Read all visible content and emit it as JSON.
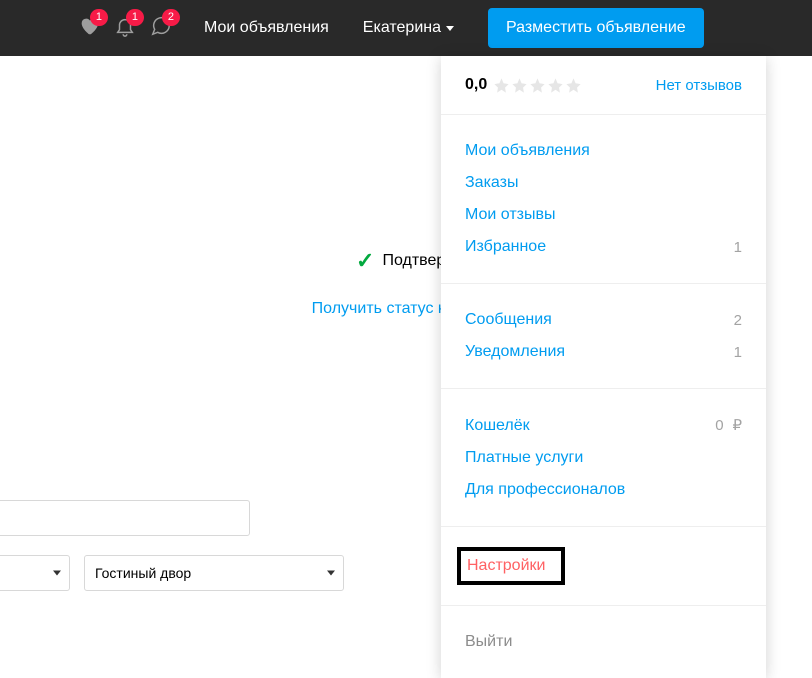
{
  "header": {
    "badges": {
      "fav": "1",
      "bell": "1",
      "chat": "2"
    },
    "nav_my_ads": "Мои объявления",
    "user_name": "Екатерина",
    "post_btn": "Разместить объявление"
  },
  "dropdown": {
    "rating": "0,0",
    "no_reviews": "Нет отзывов",
    "sec1": [
      {
        "label": "Мои объявления",
        "count": ""
      },
      {
        "label": "Заказы",
        "count": ""
      },
      {
        "label": "Мои отзывы",
        "count": ""
      },
      {
        "label": "Избранное",
        "count": "1"
      }
    ],
    "sec2": [
      {
        "label": "Сообщения",
        "count": "2"
      },
      {
        "label": "Уведомления",
        "count": "1"
      }
    ],
    "sec3": [
      {
        "label": "Кошелёк",
        "count": "0",
        "cur": "₽"
      },
      {
        "label": "Платные услуги",
        "count": ""
      },
      {
        "label": "Для профессионалов",
        "count": ""
      }
    ],
    "settings": "Настройки",
    "logout": "Выйти"
  },
  "page": {
    "verified": "Подтверж",
    "company_link": "Получить статус компани"
  },
  "form": {
    "metro": "Гостиный двор"
  }
}
